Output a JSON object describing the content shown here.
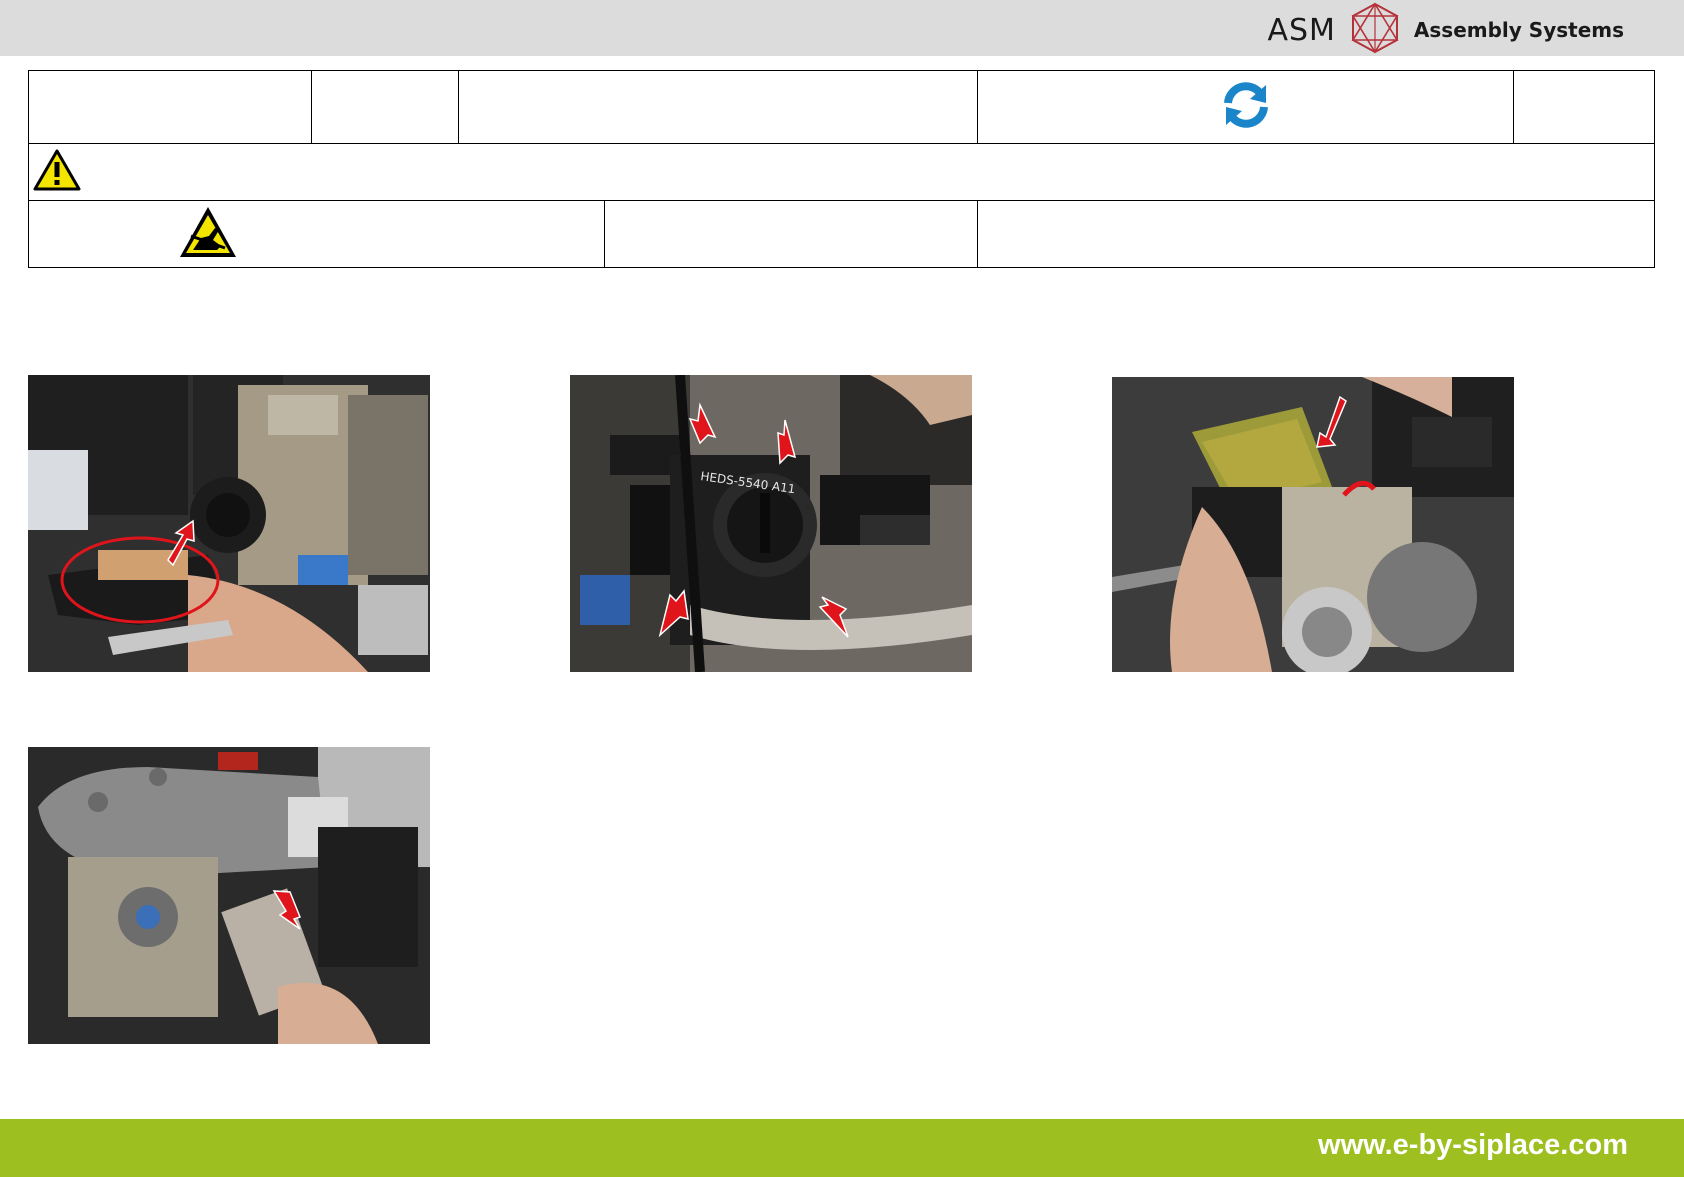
{
  "header": {
    "brand_short": "ASM",
    "brand_sub": "Assembly Systems",
    "logo_icon": "asm-hexagon-logo-icon",
    "logo_color": "#b5323a"
  },
  "info_table": {
    "refresh_icon": "refresh-icon",
    "refresh_color": "#1a86c9",
    "warning_icon": "warning-triangle-icon",
    "esd_icon": "esd-warning-icon"
  },
  "photos": [
    {
      "name": "photo-step-1",
      "arrows": 1,
      "marking": "red-ellipse"
    },
    {
      "name": "photo-step-2",
      "arrows": 4,
      "label": "HEDS-5540 A11"
    },
    {
      "name": "photo-step-3",
      "arrows": 2
    },
    {
      "name": "photo-step-4",
      "arrows": 1
    }
  ],
  "footer": {
    "url": "www.e-by-siplace.com",
    "color": "#9dbf1f"
  }
}
